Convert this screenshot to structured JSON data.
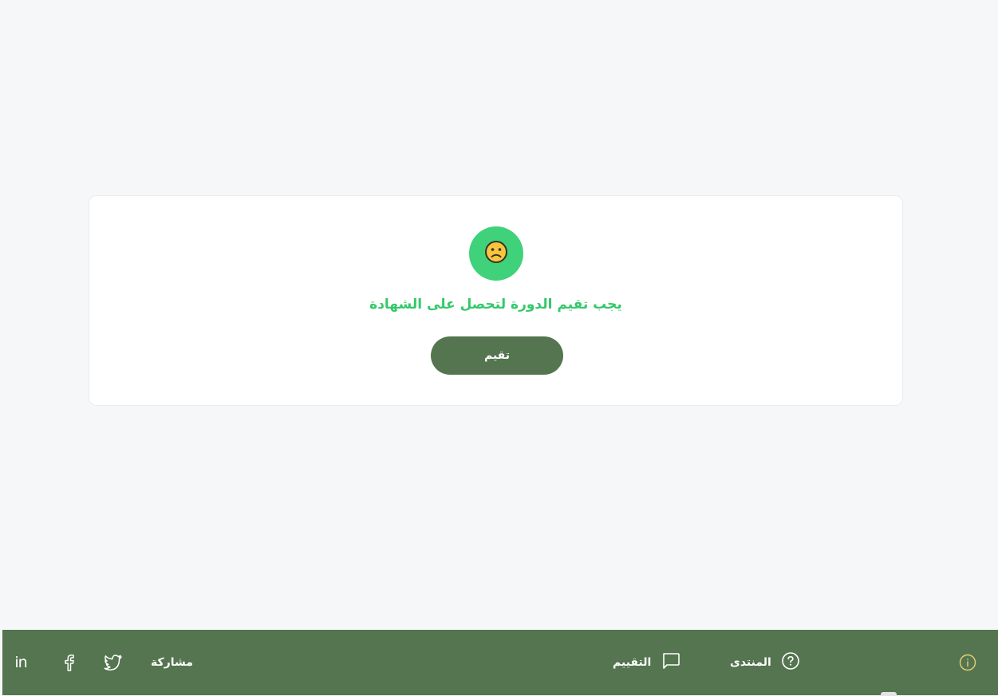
{
  "card": {
    "emoji": "sad-face",
    "message": "يجب تقيم الدورة لتحصل على الشهادة",
    "button_label": "تقيم"
  },
  "footer": {
    "forum_label": "المنتدى",
    "rating_label": "التقييم",
    "share_label": "مشاركة",
    "linkedin_text": "in"
  },
  "colors": {
    "background": "#f6f7f9",
    "accent_green": "#3fd27a",
    "message_green": "#35c86b",
    "primary_dark_green": "#54754f",
    "emoji_yellow": "#f7c53f",
    "info_icon_gold": "#e6d17a"
  },
  "icons": {
    "emoji": "sad-face-icon",
    "forum": "question-circle-icon",
    "rating": "chat-bubble-icon",
    "twitter": "twitter-icon",
    "facebook": "facebook-icon",
    "linkedin": "linkedin-icon",
    "info": "info-circle-icon"
  }
}
